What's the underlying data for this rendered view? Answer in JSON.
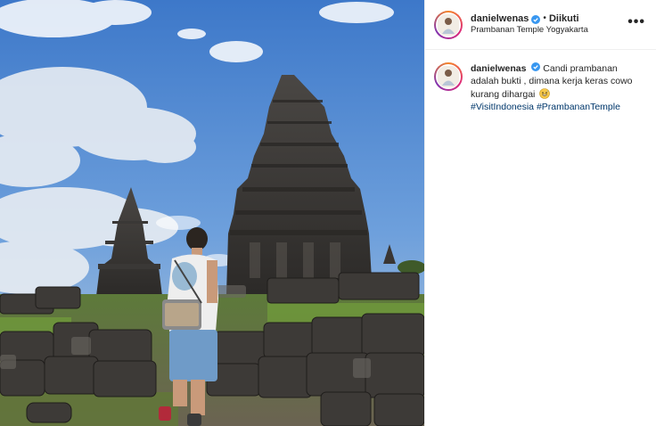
{
  "post": {
    "username": "danielwenas",
    "follow_status": "Diikuti",
    "separator": "•",
    "location": "Prambanan Temple Yogyakarta",
    "more_label": "•••",
    "caption_text": "Candi prambanan adalah bukti , dimana kerja keras cowo kurang dihargai",
    "caption_emoji": "grinning-sweat-emoji",
    "hashtags": "#VisitIndonesia #PrambananTemple"
  },
  "icons": {
    "verified": "verified-badge-icon",
    "more": "more-options-icon"
  },
  "colors": {
    "verified_blue": "#3897f0",
    "hashtag_blue": "#00376b",
    "text": "#262626",
    "divider": "#efefef"
  }
}
